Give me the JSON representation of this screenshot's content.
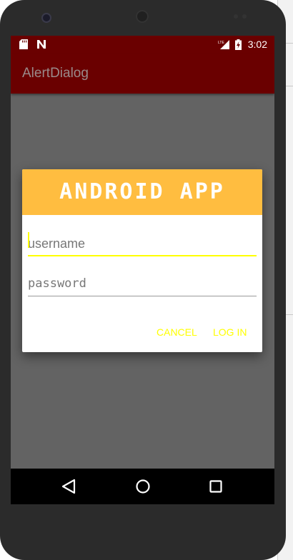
{
  "status_bar": {
    "time": "3:02"
  },
  "app_bar": {
    "title": "AlertDialog"
  },
  "dialog": {
    "banner_text": "ANDROID APP",
    "username_placeholder": "username",
    "password_placeholder": "password",
    "cancel_label": "CANCEL",
    "login_label": "LOG IN"
  },
  "colors": {
    "app_bar": "#6a0000",
    "banner": "#ffbd40",
    "accent": "#ffff00",
    "scrim": "#636363"
  },
  "icons": {
    "status": [
      "sd-card-icon",
      "n-notification-icon",
      "lte-signal-icon",
      "battery-charging-icon"
    ],
    "nav": [
      "back-icon",
      "home-icon",
      "recents-icon"
    ]
  }
}
